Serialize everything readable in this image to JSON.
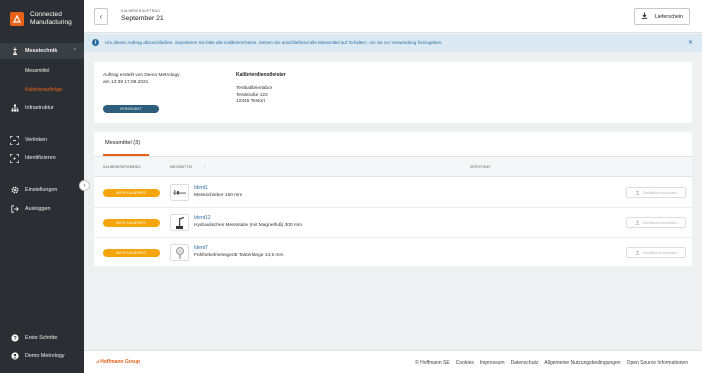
{
  "app": {
    "brand_line1": "Connected",
    "brand_line2": "Manufacturing"
  },
  "sidebar": {
    "messtechnik": "Messtechnik",
    "messmittel": "Messmittel",
    "kalibrierauftraege": "Kalibrieraufträge",
    "infrastruktur": "Infrastruktur",
    "verlinken": "Verlinken",
    "identifizieren": "Identifizieren",
    "einstellungen": "Einstellungen",
    "ausloggen": "Ausloggen",
    "erste_schritte": "Erste Schritte",
    "user": "Demo Metrology"
  },
  "header": {
    "overline": "KALIBRIERAUFTRAG",
    "title": "September 21",
    "lieferschein": "Lieferschein"
  },
  "banner": {
    "text": "Um diesen Auftrag abzuschließen, importieren Sie bitte alle Kalibrierscheine. Setzen Sie anschließend alle Messmittel auf 'Erhalten', um sie zur Verwendung freizugeben."
  },
  "order": {
    "created_by": "Auftrag erstellt von Demo Metrology",
    "created_at": "am 13:38 17.09.2021",
    "status": "VERSENDET",
    "provider_title": "Kalibrierdienstleister",
    "provider_name": "Testkalibrierlabor",
    "provider_street": "Teststraße 123",
    "provider_city": "12345 Testort"
  },
  "tabs": {
    "messmittel": "Messmittel (3)"
  },
  "table": {
    "col_ergebnis": "KALIBRIERERGEBNIS",
    "col_messmittel": "MESSMITTEL",
    "col_sort": "↑",
    "col_zertifikat": "ZERTIFIKAT",
    "rows": [
      {
        "status": "WIRD KALIBRIERT",
        "id": "Ident1",
        "desc": "Messschieber 150 mm",
        "cert": "Zertifikat hochladen",
        "thumb_icon": "caliper-icon"
      },
      {
        "status": "WIRD KALIBRIERT",
        "id": "Ident12",
        "desc": "Hydraulisches Messstativ (mit Magnetfuß) 300 mm",
        "cert": "Zertifikat hochladen",
        "thumb_icon": "stand-icon"
      },
      {
        "status": "WIRD KALIBRIERT",
        "id": "Ident7",
        "desc": "Fühlhebelmessgerät Tasterlänge 14,5 mm",
        "cert": "Zertifikat hochladen",
        "thumb_icon": "dial-gauge-icon"
      }
    ]
  },
  "footer": {
    "logo": "Hoffmann Group",
    "copyright": "© Hoffmann SE",
    "cookies": "Cookies",
    "impressum": "Impressum",
    "datenschutz": "Datenschutz",
    "agb": "Allgemeine Nutzungsbedingungen",
    "oss": "Open Source Informationen"
  },
  "colors": {
    "accent": "#e8621a",
    "sidebar": "#2b2f33",
    "status_badge": "#f5a50b",
    "sent_badge": "#2c5d7c",
    "info": "#2d6ea3"
  }
}
